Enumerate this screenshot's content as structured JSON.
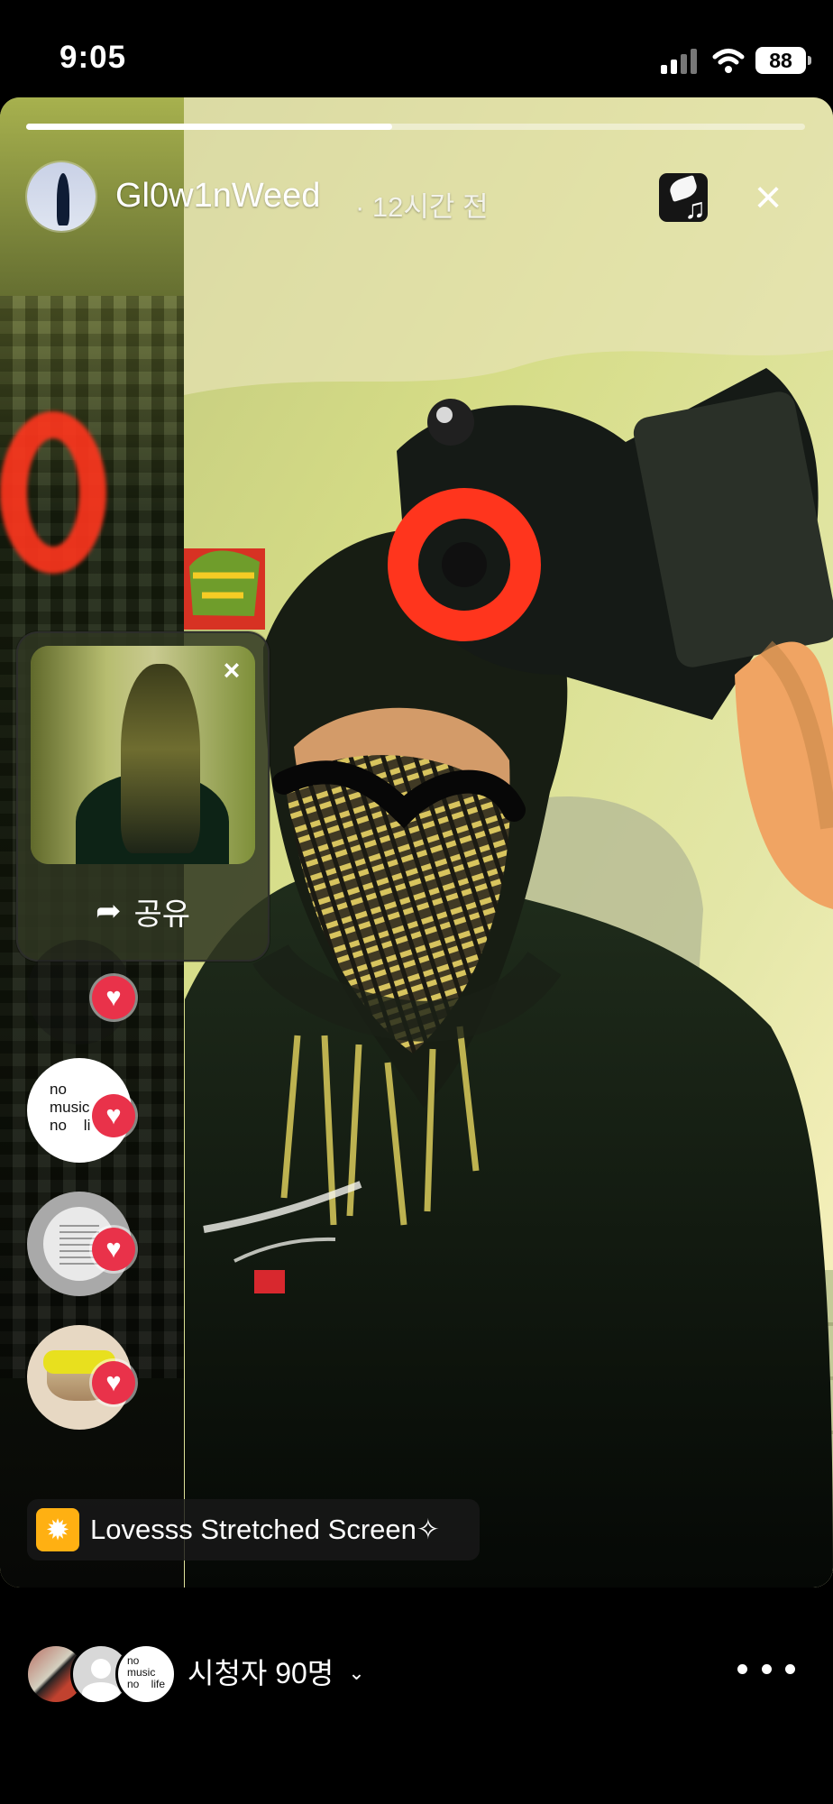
{
  "status_bar": {
    "time": "9:05",
    "battery": "88"
  },
  "story": {
    "progress": 0.47,
    "username": "Gl0w1nWeed",
    "time_ago": "· 12시간 전",
    "close_icon": "×",
    "music_icon": "♫"
  },
  "share_panel": {
    "close_icon": "×",
    "share_icon": "➦",
    "share_label": "공유"
  },
  "reaction_rail": [
    {
      "text": "",
      "heart": "♥"
    },
    {
      "text": "no\nmusic\nno    li",
      "heart": "♥"
    },
    {
      "text": "",
      "heart": "♥"
    },
    {
      "text": "",
      "heart": "♥"
    }
  ],
  "effect": {
    "icon": "✹",
    "name": "Lovesss Stretched Screen✧"
  },
  "viewers": {
    "count_label": "시청자 90명",
    "chevron": "⌄",
    "third_avatar_text": "no\nmusic\nno    life"
  },
  "colors": {
    "heart": "#e9324a",
    "effect_icon": "#ffb012",
    "red_goggles": "#ff351d"
  }
}
